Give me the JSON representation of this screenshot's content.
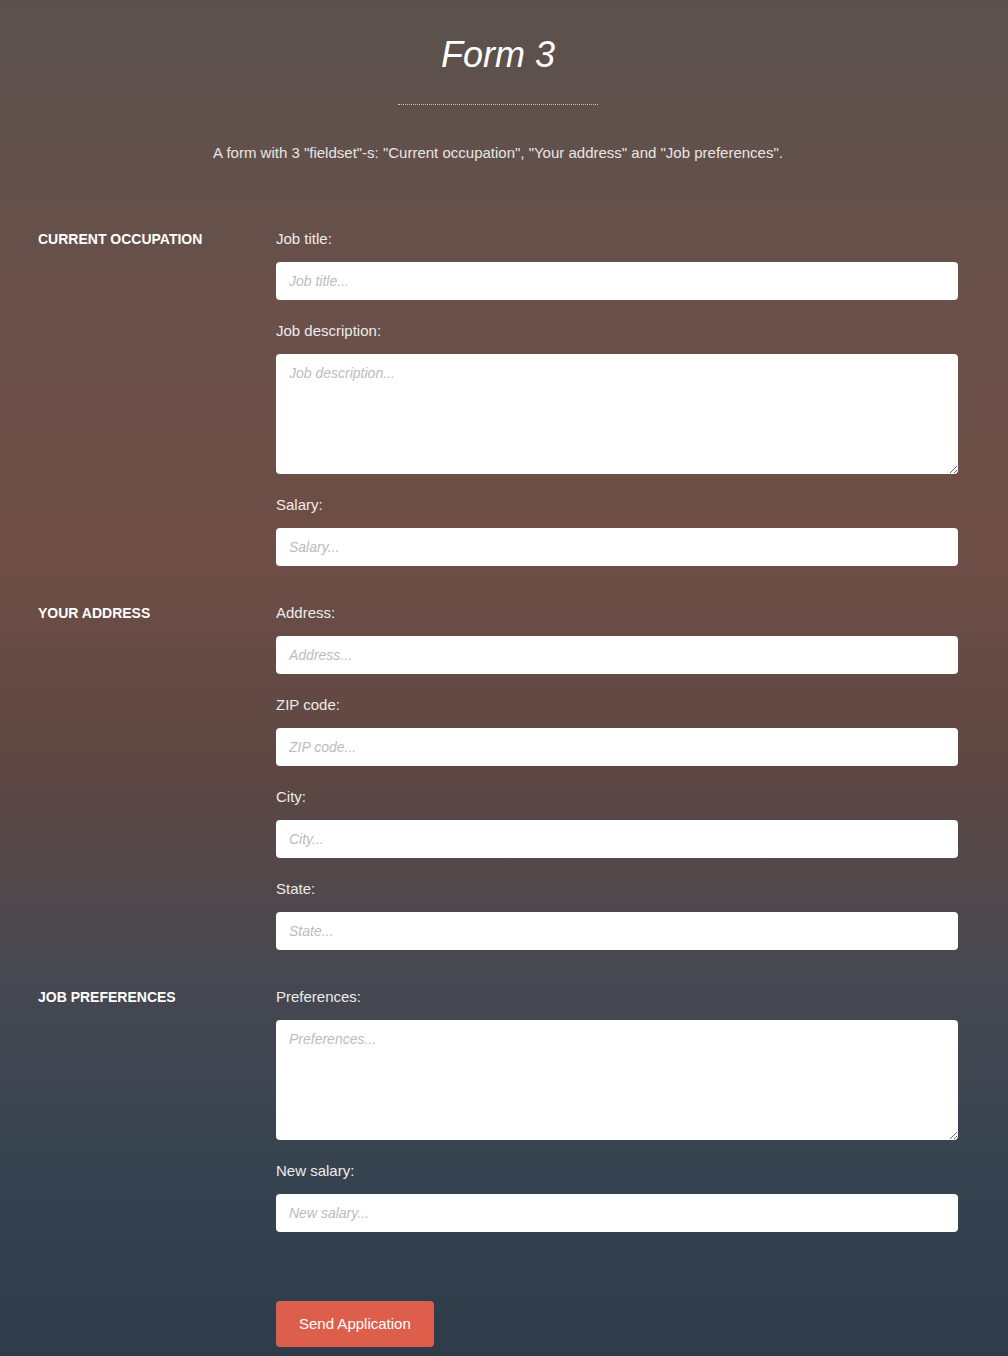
{
  "page": {
    "title": "Form 3",
    "description": "A form with 3 \"fieldset\"-s: \"Current occupation\", \"Your address\" and \"Job preferences\"."
  },
  "fieldsets": [
    {
      "legend": "CURRENT OCCUPATION",
      "fields": [
        {
          "label": "Job title:",
          "placeholder": "Job title...",
          "kind": "input"
        },
        {
          "label": "Job description:",
          "placeholder": "Job description...",
          "kind": "textarea"
        },
        {
          "label": "Salary:",
          "placeholder": "Salary...",
          "kind": "input"
        }
      ]
    },
    {
      "legend": "YOUR ADDRESS",
      "fields": [
        {
          "label": "Address:",
          "placeholder": "Address...",
          "kind": "input"
        },
        {
          "label": "ZIP code:",
          "placeholder": "ZIP code...",
          "kind": "input"
        },
        {
          "label": "City:",
          "placeholder": "City...",
          "kind": "input"
        },
        {
          "label": "State:",
          "placeholder": "State...",
          "kind": "input"
        }
      ]
    },
    {
      "legend": "JOB PREFERENCES",
      "fields": [
        {
          "label": "Preferences:",
          "placeholder": "Preferences...",
          "kind": "textarea"
        },
        {
          "label": "New salary:",
          "placeholder": "New salary...",
          "kind": "input"
        }
      ]
    }
  ],
  "submit": {
    "label": "Send Application"
  }
}
